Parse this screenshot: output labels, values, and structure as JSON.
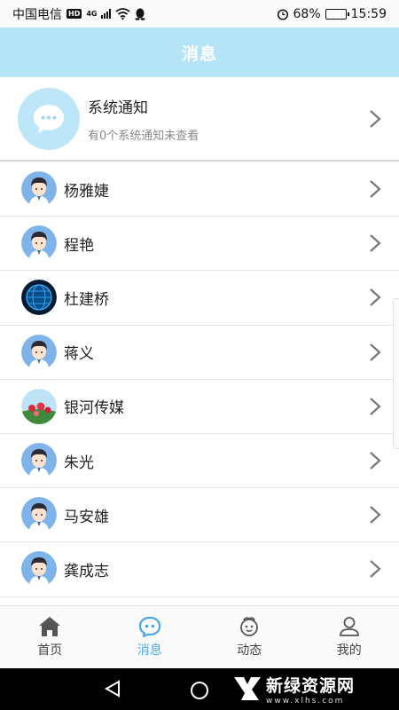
{
  "status_bar": {
    "carrier": "中国电信",
    "hd": "HD",
    "network": "4G",
    "battery": "68%",
    "battery_level": 0.68,
    "time": "15:59"
  },
  "header": {
    "title": "消息"
  },
  "system_notice": {
    "title": "系统通知",
    "subtitle": "有0个系统通知未查看"
  },
  "contacts": [
    {
      "name": "杨雅婕",
      "avatar": "cartoon-boy"
    },
    {
      "name": "程艳",
      "avatar": "cartoon-boy"
    },
    {
      "name": "杜建桥",
      "avatar": "blue-globe"
    },
    {
      "name": "蒋义",
      "avatar": "cartoon-boy"
    },
    {
      "name": "银河传媒",
      "avatar": "flower-photo"
    },
    {
      "name": "朱光",
      "avatar": "cartoon-boy"
    },
    {
      "name": "马安雄",
      "avatar": "cartoon-boy"
    },
    {
      "name": "龚成志",
      "avatar": "cartoon-boy"
    }
  ],
  "tabbar": {
    "tabs": [
      {
        "label": "首页",
        "icon": "home-icon"
      },
      {
        "label": "消息",
        "icon": "message-icon",
        "active": true
      },
      {
        "label": "动态",
        "icon": "moments-icon"
      },
      {
        "label": "我的",
        "icon": "profile-icon"
      }
    ]
  },
  "watermark": {
    "title": "新绿资源网",
    "url": "www.xlhs.com"
  },
  "colors": {
    "header_bg": "#b5e4f7",
    "accent": "#4aa8e8",
    "text": "#222222",
    "subtext": "#888888"
  }
}
